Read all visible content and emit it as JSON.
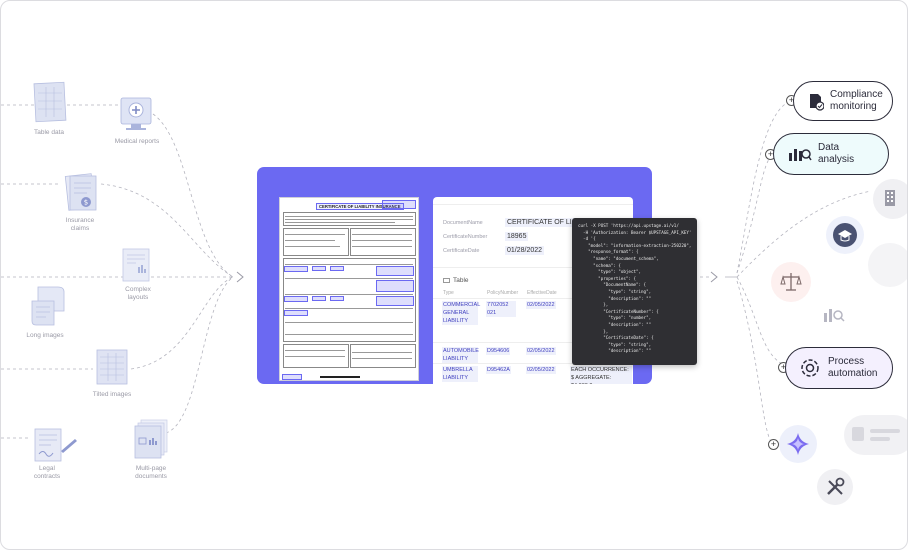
{
  "inputs": [
    {
      "label": "Table data",
      "icon": "table-data-icon"
    },
    {
      "label": "Medical reports",
      "icon": "medical-report-icon"
    },
    {
      "label": "Insurance claims",
      "icon": "insurance-claims-icon"
    },
    {
      "label": "Complex layouts",
      "icon": "complex-layout-icon"
    },
    {
      "label": "Long images",
      "icon": "long-image-icon"
    },
    {
      "label": "Tilted images",
      "icon": "tilted-image-icon"
    },
    {
      "label": "Legal contracts",
      "icon": "legal-contract-icon"
    },
    {
      "label": "Multi-page documents",
      "icon": "multipage-document-icon"
    }
  ],
  "document": {
    "title": "CERTIFICATE OF LIABILITY INSURANCE"
  },
  "extraction": {
    "fields": [
      {
        "key": "DocumentName",
        "value": "CERTIFICATE OF LIABILITY"
      },
      {
        "key": "CertificateNumber",
        "value": "18965"
      },
      {
        "key": "CertificateDate",
        "value": "01/28/2022"
      }
    ],
    "table_title": "Table",
    "table_headers": [
      "Type",
      "PolicyNumber",
      "EffectiveDate"
    ],
    "rows": [
      {
        "type": "COMMERCIAL GENERAL LIABILITY",
        "policy": "7702052 021",
        "date": "02/05/2022"
      },
      {
        "type": "AUTOMOBILE LIABILITY",
        "policy": "D954606",
        "date": "02/05/2022"
      },
      {
        "type": "UMBRELLA LIABILITY",
        "policy": "D95462A",
        "date": "02/05/2022"
      }
    ],
    "extra_cell": "EACH OCCURRENCE: $ AGGREGATE: $4,000,0"
  },
  "code_snippet": "curl -X POST 'https://api.upstage.ai/v1/\n  -H 'Authorization: Bearer $UPSTAGE_API_KEY'\n  -d '{\n    \"model\": \"information-extraction-250220\",\n    \"response_format\": {\n      \"name\": \"document_schema\",\n      \"schema\": {\n        \"type\": \"object\",\n        \"properties\": {\n          \"DocumentName\": {\n            \"type\": \"string\",\n            \"description\": \"\"\n          },\n          \"CertificateNumber\": {\n            \"type\": \"number\",\n            \"description\": \"\"\n          },\n          \"CertificateDate\": {\n            \"type\": \"string\",\n            \"description\": \"\"",
  "outputs": [
    {
      "label": "Compliance monitoring",
      "icon": "compliance-icon"
    },
    {
      "label": "Data analysis",
      "icon": "data-analysis-icon"
    },
    {
      "label": "Process automation",
      "icon": "process-automation-icon"
    }
  ],
  "colors": {
    "accent": "#6b69f2",
    "line": "#9a9aa6",
    "highlight": "#eef0fb",
    "code_bg": "#2f2f33"
  }
}
